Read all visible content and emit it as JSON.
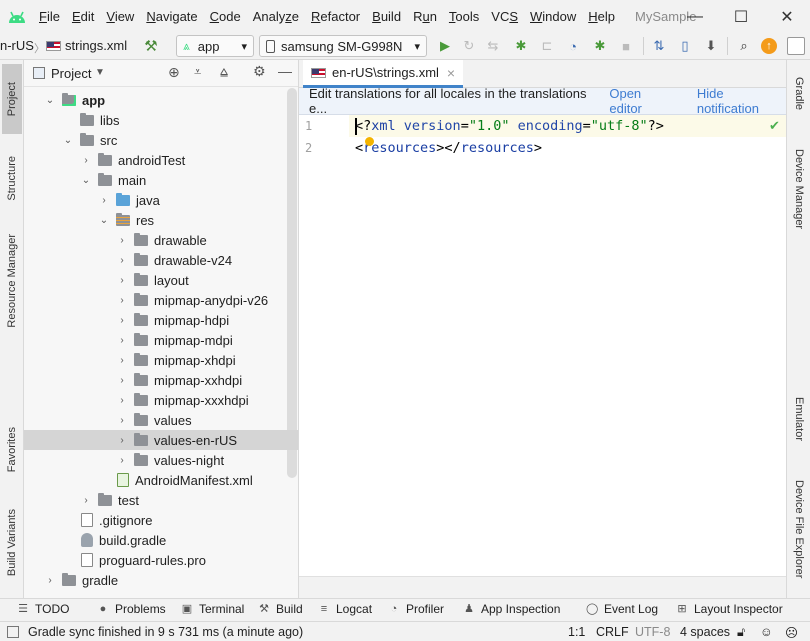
{
  "titlebar": {
    "menu": [
      {
        "label": "File",
        "u": "F",
        "rest": "ile"
      },
      {
        "label": "Edit",
        "u": "E",
        "rest": "dit"
      },
      {
        "label": "View",
        "u": "V",
        "rest": "iew"
      },
      {
        "label": "Navigate",
        "u": "N",
        "rest": "avigate"
      },
      {
        "label": "Code",
        "u": "C",
        "rest": "ode"
      },
      {
        "label": "Analyze",
        "pre": "Analy",
        "u": "z",
        "rest": "e"
      },
      {
        "label": "Refactor",
        "u": "R",
        "rest": "efactor"
      },
      {
        "label": "Build",
        "u": "B",
        "rest": "uild"
      },
      {
        "label": "Run",
        "pre": "R",
        "u": "u",
        "rest": "n"
      },
      {
        "label": "Tools",
        "u": "T",
        "rest": "ools"
      },
      {
        "label": "VCS",
        "pre": "VC",
        "u": "S",
        "rest": ""
      },
      {
        "label": "Window",
        "u": "W",
        "rest": "indow"
      },
      {
        "label": "Help",
        "u": "H",
        "rest": "elp"
      }
    ],
    "app_title": "MySample",
    "minimize": "—",
    "maximize": "☐",
    "close": "✕"
  },
  "toolbar": {
    "breadcrumb_folder": "n-rUS",
    "breadcrumb_sep": "〉",
    "breadcrumb_file": "strings.xml",
    "run_config": "app",
    "device": "samsung SM-G998N",
    "dropdown_arrow": "▾"
  },
  "left_tabs": {
    "project": "Project",
    "structure": "Structure",
    "resource_manager": "Resource Manager",
    "favorites": "Favorites",
    "build_variants": "Build Variants"
  },
  "right_tabs": {
    "gradle": "Gradle",
    "device_manager": "Device Manager",
    "emulator": "Emulator",
    "device_file_explorer": "Device File Explorer"
  },
  "project_panel": {
    "title": "Project",
    "tree": [
      {
        "label": "app",
        "depth": 1,
        "chev": "⌄",
        "kind": "module",
        "bold": true
      },
      {
        "label": "libs",
        "depth": 2,
        "chev": "",
        "kind": "folder"
      },
      {
        "label": "src",
        "depth": 2,
        "chev": "⌄",
        "kind": "folder"
      },
      {
        "label": "androidTest",
        "depth": 3,
        "chev": "›",
        "kind": "folder"
      },
      {
        "label": "main",
        "depth": 3,
        "chev": "⌄",
        "kind": "folder"
      },
      {
        "label": "java",
        "depth": 4,
        "chev": "›",
        "kind": "folder-blue"
      },
      {
        "label": "res",
        "depth": 4,
        "chev": "⌄",
        "kind": "folder-res"
      },
      {
        "label": "drawable",
        "depth": 5,
        "chev": "›",
        "kind": "folder"
      },
      {
        "label": "drawable-v24",
        "depth": 5,
        "chev": "›",
        "kind": "folder"
      },
      {
        "label": "layout",
        "depth": 5,
        "chev": "›",
        "kind": "folder"
      },
      {
        "label": "mipmap-anydpi-v26",
        "depth": 5,
        "chev": "›",
        "kind": "folder"
      },
      {
        "label": "mipmap-hdpi",
        "depth": 5,
        "chev": "›",
        "kind": "folder"
      },
      {
        "label": "mipmap-mdpi",
        "depth": 5,
        "chev": "›",
        "kind": "folder"
      },
      {
        "label": "mipmap-xhdpi",
        "depth": 5,
        "chev": "›",
        "kind": "folder"
      },
      {
        "label": "mipmap-xxhdpi",
        "depth": 5,
        "chev": "›",
        "kind": "folder"
      },
      {
        "label": "mipmap-xxxhdpi",
        "depth": 5,
        "chev": "›",
        "kind": "folder"
      },
      {
        "label": "values",
        "depth": 5,
        "chev": "›",
        "kind": "folder"
      },
      {
        "label": "values-en-rUS",
        "depth": 5,
        "chev": "›",
        "kind": "folder",
        "selected": true
      },
      {
        "label": "values-night",
        "depth": 5,
        "chev": "›",
        "kind": "folder"
      },
      {
        "label": "AndroidManifest.xml",
        "depth": 4,
        "chev": "",
        "kind": "manifest"
      },
      {
        "label": "test",
        "depth": 3,
        "chev": "›",
        "kind": "folder"
      },
      {
        "label": ".gitignore",
        "depth": 2,
        "chev": "",
        "kind": "file"
      },
      {
        "label": "build.gradle",
        "depth": 2,
        "chev": "",
        "kind": "gradle"
      },
      {
        "label": "proguard-rules.pro",
        "depth": 2,
        "chev": "",
        "kind": "file"
      },
      {
        "label": "gradle",
        "depth": 1,
        "chev": "›",
        "kind": "folder"
      }
    ]
  },
  "editor": {
    "tab_label": "en-rUS\\strings.xml",
    "tab_close": "×",
    "notification_text": "Edit translations for all locales in the translations e...",
    "open_editor": "Open editor",
    "hide_notification": "Hide notification",
    "line_numbers": [
      "1",
      "2"
    ],
    "line1": {
      "open": "<?",
      "tag": "xml",
      "attr1": " version",
      "eq1": "=",
      "val1": "\"1.0\"",
      "attr2": " encoding",
      "eq2": "=",
      "val2": "\"utf-8\"",
      "close": "?>"
    },
    "line2": {
      "lt1": "<",
      "tag1": "resources",
      "mid": "></",
      "tag2": "resources",
      "gt": ">"
    },
    "check": "✔"
  },
  "bottom_tools": [
    {
      "label": "TODO",
      "icon": "☰"
    },
    {
      "label": "Problems",
      "icon": "●"
    },
    {
      "label": "Terminal",
      "icon": "▣"
    },
    {
      "label": "Build",
      "icon": "⚒"
    },
    {
      "label": "Logcat",
      "icon": "≡"
    },
    {
      "label": "Profiler",
      "icon": "◔"
    },
    {
      "label": "App Inspection",
      "icon": "♟"
    },
    {
      "label": "Event Log",
      "icon": "◯"
    },
    {
      "label": "Layout Inspector",
      "icon": "⊞"
    }
  ],
  "status": {
    "message": "Gradle sync finished in 9 s 731 ms (a minute ago)",
    "position": "1:1",
    "line_sep": "CRLF",
    "encoding": "UTF-8",
    "indent": "4 spaces"
  },
  "colors": {
    "accent": "#4083c9",
    "selection": "#d5d5d5",
    "notification_bg": "#eef3fa",
    "android_green": "#3ddc84"
  }
}
